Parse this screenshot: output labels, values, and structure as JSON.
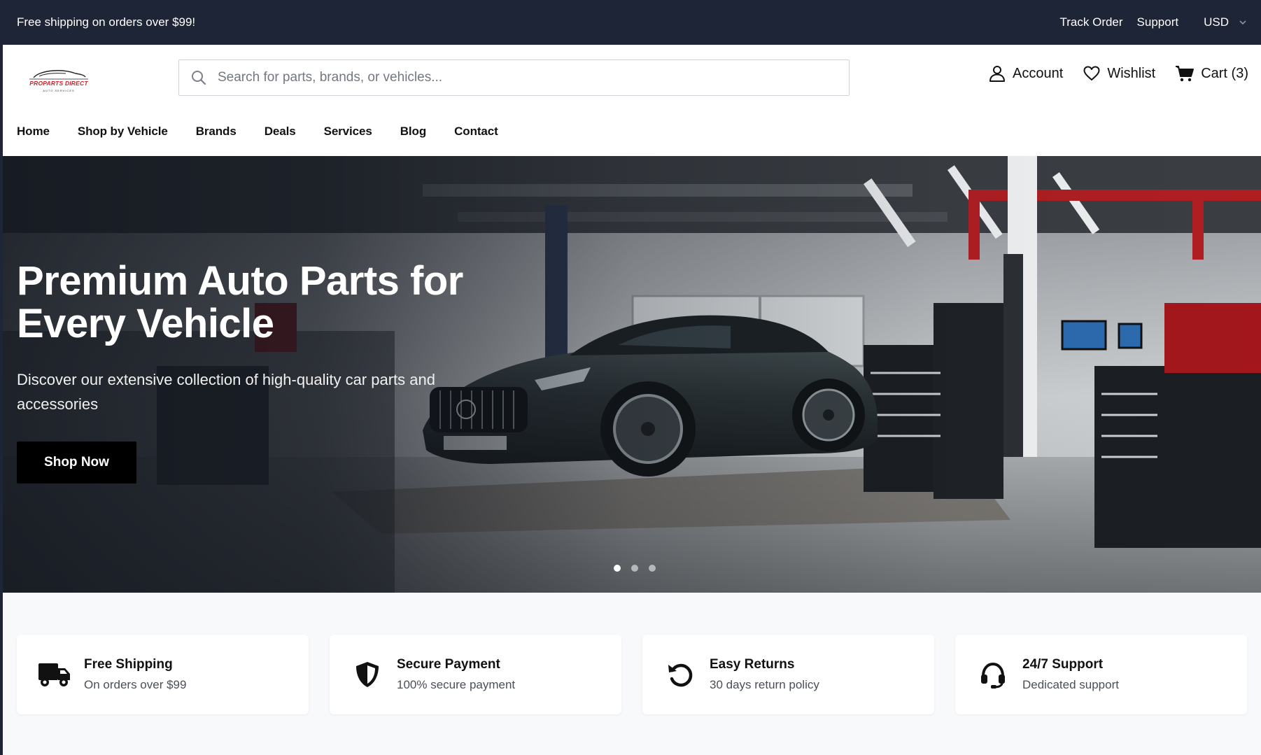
{
  "topbar": {
    "promo": "Free shipping on orders over $99!",
    "links": [
      "Track Order",
      "Support"
    ],
    "currency": "USD"
  },
  "header": {
    "logo_text": "PROPARTS DIRECT",
    "logo_sub": "AUTO SERVICES",
    "search_placeholder": "Search for parts, brands, or vehicles...",
    "account_label": "Account",
    "wishlist_label": "Wishlist",
    "cart_label": "Cart (3)"
  },
  "nav": {
    "items": [
      "Home",
      "Shop by Vehicle",
      "Brands",
      "Deals",
      "Services",
      "Blog",
      "Contact"
    ]
  },
  "hero": {
    "title": "Premium Auto Parts for Every Vehicle",
    "subtitle": "Discover our extensive collection of high-quality car parts and accessories",
    "button_label": "Shop Now",
    "slides": 3,
    "active_slide": 1
  },
  "features": [
    {
      "icon": "truck-icon",
      "title": "Free Shipping",
      "desc": "On orders over $99"
    },
    {
      "icon": "shield-icon",
      "title": "Secure Payment",
      "desc": "100% secure payment"
    },
    {
      "icon": "undo-icon",
      "title": "Easy Returns",
      "desc": "30 days return policy"
    },
    {
      "icon": "headset-icon",
      "title": "24/7 Support",
      "desc": "Dedicated support"
    }
  ],
  "colors": {
    "topbar_bg": "#1e2536",
    "accent_red": "#d0202a",
    "button_bg": "#000000",
    "features_bg": "#f8f9fa"
  }
}
